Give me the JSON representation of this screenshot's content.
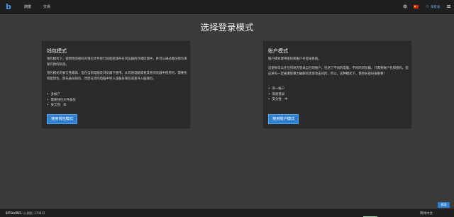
{
  "topbar": {
    "logo_glyph": "b",
    "nav": [
      {
        "label": "浏览",
        "active": true
      },
      {
        "label": "交易",
        "active": false
      }
    ],
    "settings_icon": "gear-icon",
    "language_flag": "cn-flag-icon",
    "login_label": "未登录",
    "person_icon": "person-icon",
    "menu_icon": "hamburger-icon"
  },
  "page_title": "选择登录模式",
  "wallet_card": {
    "title": "钱包模式",
    "para1": "钱包模式下，使用你的密码对钱包文件进行加密后保存在浏览器的存储区域中，并可以通过备份钱包来保存你的私钥。",
    "para2": "钱包模式的安全性最高，但在当前电脑及浏览器下使用。从其他电脑或者其他浏览器中使用时，需要先恢复钱包，即先备份钱包，然后在目的电脑中导入该备份钱包或者导入脑钱包。",
    "features": [
      "多帐户",
      "需要钱包文件备份",
      "安全性：高"
    ],
    "button": "使用钱包模式"
  },
  "account_card": {
    "title": "账户模式",
    "para1": "账户模式使用密码和账户名登录系统。",
    "para2": "这使你可以在任何地方登录自己的账户，包括了不同的电脑、不同的浏览器。只需要账户名和密码。但这将有一定被遭受暴力破解的黑客攻击风险，所以，这种模式下，使用长密码很重要！",
    "features": [
      "单一帐户",
      "简易登录",
      "安全性：中"
    ],
    "button": "使用账户模式"
  },
  "footer": {
    "version_name": "BITSHARES",
    "version_channel": "(公测版)",
    "version_number": "170815",
    "language_label": "简体中文",
    "float_button": "帮助"
  }
}
